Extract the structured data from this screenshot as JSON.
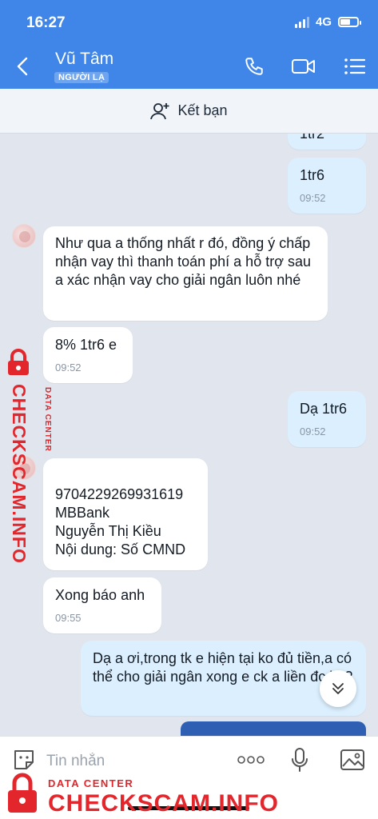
{
  "status": {
    "time": "16:27",
    "network": "4G"
  },
  "header": {
    "contact_name": "Vũ Tâm",
    "badge": "NGƯỜI LẠ"
  },
  "add_friend": {
    "label": "Kết bạn"
  },
  "messages": [
    {
      "dir": "out",
      "text": "1tr2",
      "time": ""
    },
    {
      "dir": "out",
      "text": "1tr6",
      "time": "09:52"
    },
    {
      "dir": "in",
      "text": "Như qua a thống nhất r đó, đồng ý chấp nhận vay thì thanh toán phí a hỗ trợ sau a xác nhận vay cho giải ngân luôn nhé",
      "time": ""
    },
    {
      "dir": "in",
      "text": "8% 1tr6 e",
      "time": "09:52"
    },
    {
      "dir": "out",
      "text": "Dạ 1tr6",
      "time": "09:52"
    },
    {
      "dir": "in",
      "lines": [
        "9704229269931619",
        "MBBank",
        "Nguyễn Thị Kiều",
        "Nội dung: Số CMND"
      ],
      "time": ""
    },
    {
      "dir": "in",
      "text": "Xong báo anh",
      "time": "09:55"
    },
    {
      "dir": "out",
      "text": "Dạ a ơi,trong tk e hiện tại ko đủ tiền,a có thể cho giải ngân xong e ck a liền đc ko?",
      "time": ""
    }
  ],
  "input": {
    "placeholder": "Tin nhắn"
  },
  "watermark": {
    "title": "CHECKSCAM.INFO",
    "subtitle": "DATA CENTER"
  },
  "colors": {
    "header": "#3f86e8",
    "outgoing_bubble": "#dbeffe",
    "incoming_bubble": "#ffffff",
    "watermark": "#e3262b"
  }
}
